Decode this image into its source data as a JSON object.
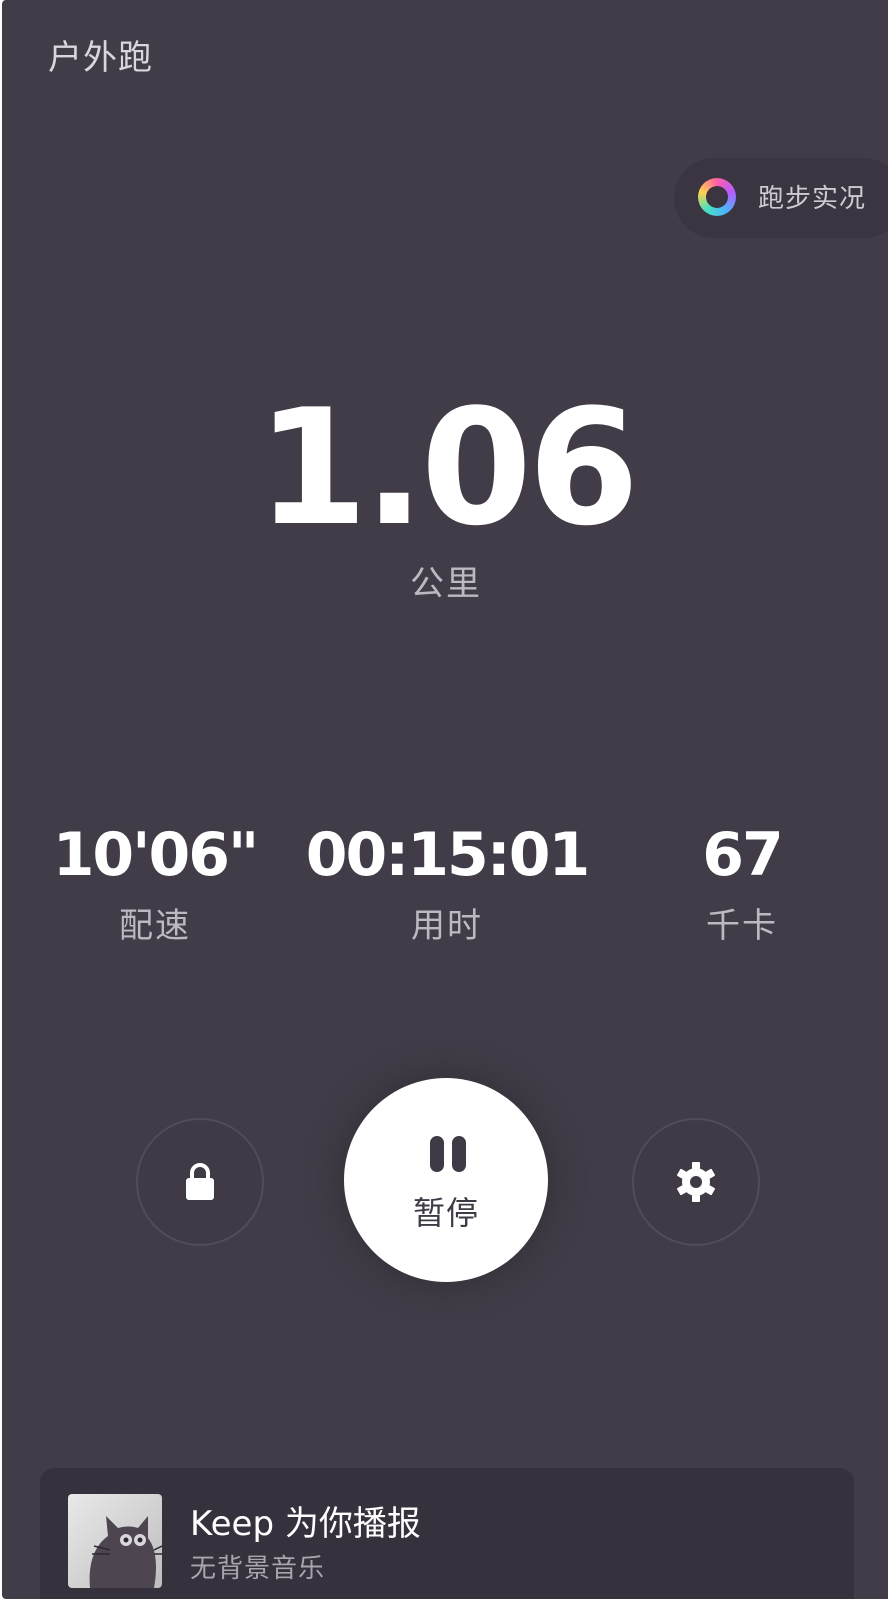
{
  "header": {
    "title": "户外跑"
  },
  "live_button": {
    "label": "跑步实况"
  },
  "distance": {
    "value": "1.06",
    "unit": "公里"
  },
  "stats": [
    {
      "value": "10'06\"",
      "label": "配速"
    },
    {
      "value": "00:15:01",
      "label": "用时"
    },
    {
      "value": "67",
      "label": "千卡"
    }
  ],
  "controls": {
    "lock_icon": "lock-icon",
    "pause_icon": "pause-icon",
    "pause_label": "暂停",
    "settings_icon": "gear-icon"
  },
  "music": {
    "title": "Keep 为你播报",
    "subtitle": "无背景音乐",
    "album_icon": "cat-illustration"
  },
  "colors": {
    "background": "#413c47",
    "primary_text": "#ffffff",
    "secondary_text": "#bdb9c2",
    "pause_button": "#ffffff"
  }
}
